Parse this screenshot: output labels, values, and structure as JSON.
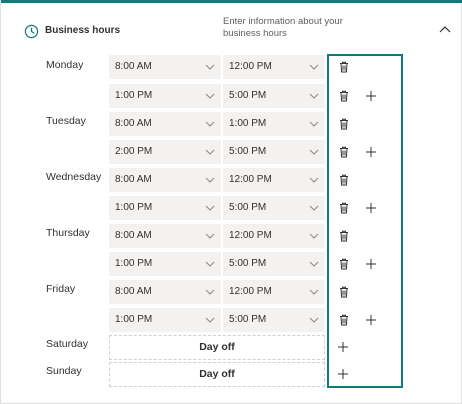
{
  "header": {
    "title": "Business hours",
    "description": "Enter information about your business hours"
  },
  "colors": {
    "accent": "#0f7c77",
    "field_bg": "#f3f2f1",
    "text": "#323130",
    "muted": "#605e5c"
  },
  "days": [
    {
      "name": "Monday",
      "ranges": [
        {
          "start": "8:00 AM",
          "end": "12:00 PM"
        },
        {
          "start": "1:00 PM",
          "end": "5:00 PM"
        }
      ]
    },
    {
      "name": "Tuesday",
      "ranges": [
        {
          "start": "8:00 AM",
          "end": "1:00 PM"
        },
        {
          "start": "2:00 PM",
          "end": "5:00 PM"
        }
      ]
    },
    {
      "name": "Wednesday",
      "ranges": [
        {
          "start": "8:00 AM",
          "end": "12:00 PM"
        },
        {
          "start": "1:00 PM",
          "end": "5:00 PM"
        }
      ]
    },
    {
      "name": "Thursday",
      "ranges": [
        {
          "start": "8:00 AM",
          "end": "12:00 PM"
        },
        {
          "start": "1:00 PM",
          "end": "5:00 PM"
        }
      ]
    },
    {
      "name": "Friday",
      "ranges": [
        {
          "start": "8:00 AM",
          "end": "12:00 PM"
        },
        {
          "start": "1:00 PM",
          "end": "5:00 PM"
        }
      ]
    },
    {
      "name": "Saturday",
      "day_off_label": "Day off"
    },
    {
      "name": "Sunday",
      "day_off_label": "Day off"
    }
  ],
  "icons": {
    "header": "clock-icon",
    "collapse": "chevron-up-icon",
    "delete": "trash-icon",
    "add": "plus-icon",
    "dropdown": "chevron-down-icon"
  }
}
